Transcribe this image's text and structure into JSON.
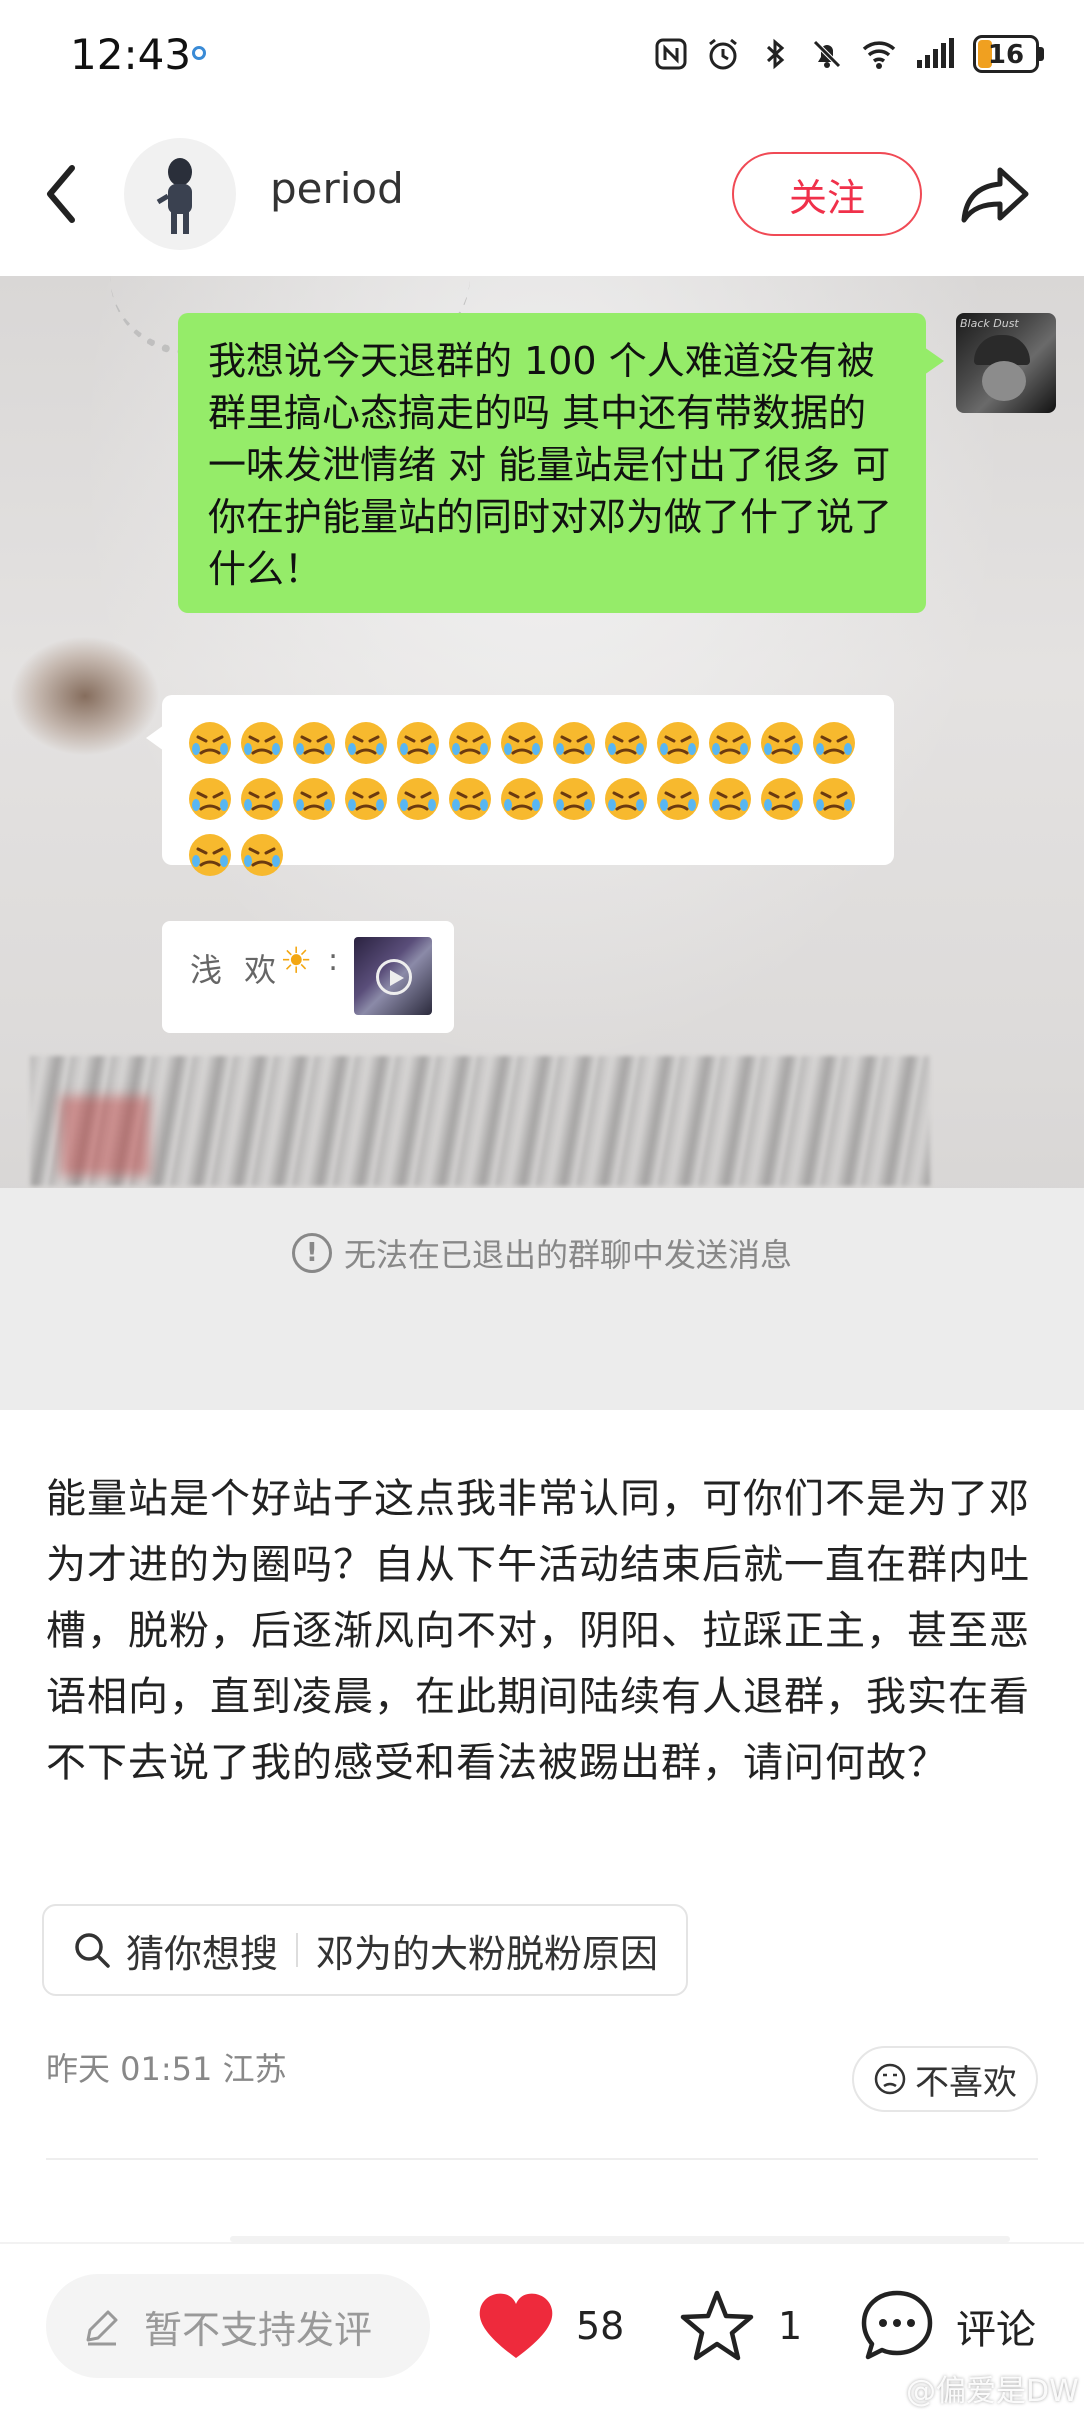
{
  "status_bar": {
    "time": "12:43",
    "battery": "16"
  },
  "header": {
    "username": "period",
    "follow_label": "关注"
  },
  "post_image": {
    "chat_message": "我想说今天退群的 100 个人难道没有被群里搞心态搞走的吗 其中还有带数据的一味发泄情绪 对 能量站是付出了很多 可你在护能量站的同时对邓为做了什了说了什么！",
    "emoji_count": 28,
    "quote_name": "浅 欢",
    "quote_colon": ":",
    "notice": "无法在已退出的群聊中发送消息"
  },
  "post": {
    "body": "能量站是个好站子这点我非常认同，可你们不是为了邓为才进的为圈吗？自从下午活动结束后就一直在群内吐槽，脱粉，后逐渐风向不对，阴阳、拉踩正主，甚至恶语相向，直到凌晨，在此期间陆续有人退群，我实在看不下去说了我的感受和看法被踢出群，请问何故？",
    "search_prefix": "猜你想搜",
    "search_query": "邓为的大粉脱粉原因",
    "meta": "昨天 01:51  江苏",
    "dislike_label": "不喜欢"
  },
  "bottom_bar": {
    "comment_placeholder": "暂不支持发评",
    "likes": "58",
    "favorites": "1",
    "comment_label": "评论",
    "watermark": "@偏爱是DW"
  },
  "colors": {
    "accent": "#f0304a",
    "chat_green": "#95ec69",
    "like_red": "#ee2a3c"
  }
}
